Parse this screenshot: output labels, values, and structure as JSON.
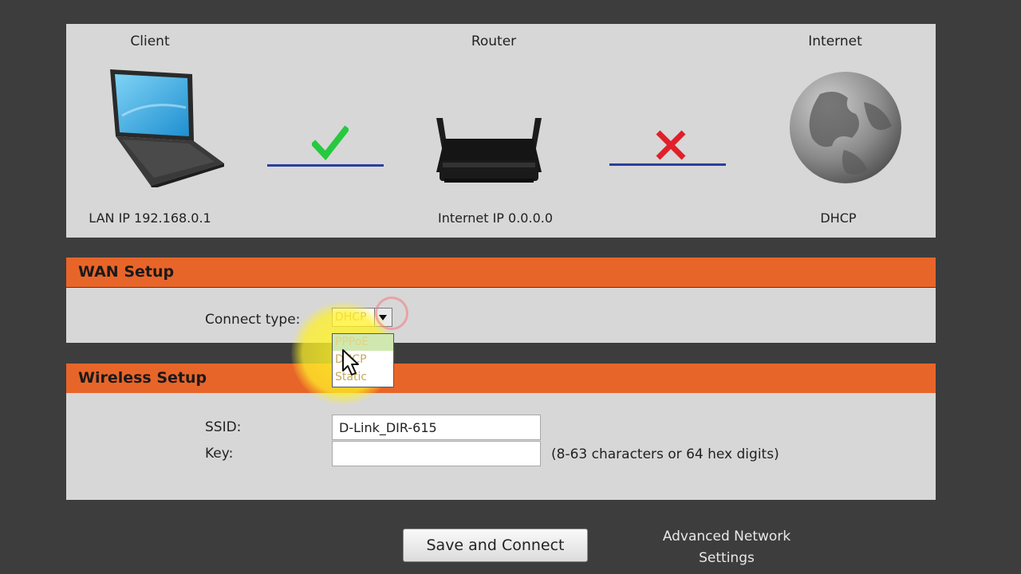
{
  "status": {
    "client": {
      "title": "Client",
      "value": "LAN IP 192.168.0.1",
      "icon": "laptop-icon"
    },
    "router": {
      "title": "Router",
      "value": "Internet IP 0.0.0.0",
      "icon": "router-icon"
    },
    "internet": {
      "title": "Internet",
      "value": "DHCP",
      "icon": "globe-icon"
    },
    "client_router_link": "connected",
    "router_internet_link": "disconnected"
  },
  "wan": {
    "title": "WAN Setup",
    "connect_type_label": "Connect type:",
    "connect_type_value": "DHCP",
    "options": [
      "PPPoE",
      "DHCP",
      "Static"
    ],
    "highlighted_option": "PPPoE"
  },
  "wireless": {
    "title": "Wireless Setup",
    "ssid_label": "SSID:",
    "ssid_value": "D-Link_DIR-615",
    "key_label": "Key:",
    "key_value": "",
    "key_hint": "(8-63 characters or 64 hex digits)"
  },
  "actions": {
    "save_label": "Save and Connect",
    "advanced_line1": "Advanced Network",
    "advanced_line2": "Settings"
  },
  "colors": {
    "accent": "#e8652a",
    "panel": "#d7d7d7",
    "background": "#3d3d3d",
    "link_line": "#2b3f9e",
    "ok": "#27c93f",
    "error": "#e0202a"
  }
}
